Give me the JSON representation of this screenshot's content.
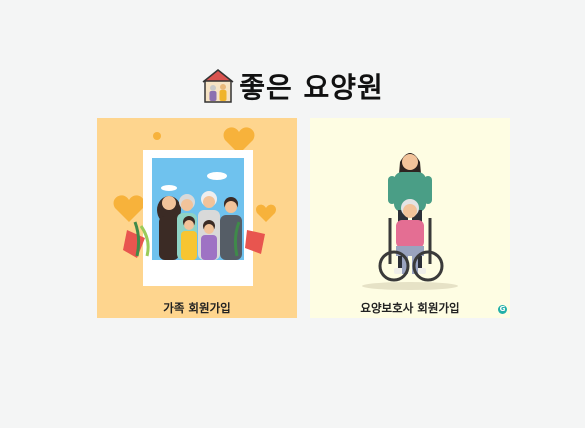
{
  "header": {
    "logo_icon": "nursing-home-icon",
    "title": "좋은 요양원"
  },
  "cards": [
    {
      "id": "family",
      "label": "가족 회원가입",
      "icon": "family-photo-illustration",
      "background": "#fed58e"
    },
    {
      "id": "caregiver",
      "label": "요양보호사 회원가입",
      "icon": "caregiver-wheelchair-illustration",
      "background": "#fefde3"
    }
  ],
  "colors": {
    "page_background": "#f4f5f5",
    "badge": "#22b0a8"
  }
}
